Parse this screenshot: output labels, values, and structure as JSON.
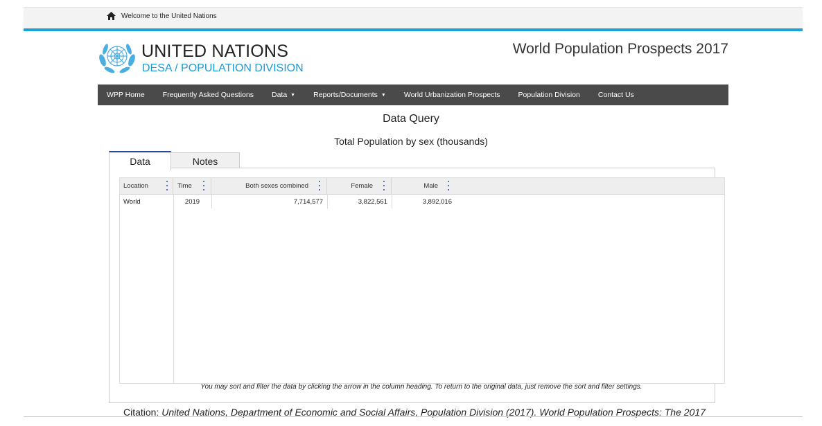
{
  "topbar": {
    "welcome": "Welcome to the United Nations",
    "accent": "#1ba1dc"
  },
  "header": {
    "org_name": "UNITED NATIONS",
    "division": "DESA / POPULATION DIVISION",
    "site_title": "World Population Prospects 2017"
  },
  "nav": {
    "items": [
      {
        "label": "WPP Home"
      },
      {
        "label": "Frequently Asked Questions"
      },
      {
        "label": "Data",
        "caret": "▼"
      },
      {
        "label": "Reports/Documents",
        "caret": "▼"
      },
      {
        "label": "World Urbanization Prospects"
      },
      {
        "label": "Population Division"
      },
      {
        "label": "Contact Us"
      }
    ]
  },
  "query": {
    "title": "Data Query",
    "subtitle": "Total Population by sex (thousands)"
  },
  "tabs": [
    {
      "label": "Data",
      "active": true
    },
    {
      "label": "Notes",
      "active": false
    }
  ],
  "table": {
    "columns": [
      "Location",
      "Time",
      "Both sexes combined",
      "Female",
      "Male"
    ],
    "rows": [
      [
        "World",
        "2019",
        "7,714,577",
        "3,822,561",
        "3,892,016"
      ]
    ]
  },
  "hint": "You may sort and filter the data by clicking the arrow in the column heading. To return to the original data, just remove the sort and filter settings.",
  "citation": {
    "label": "Citation:",
    "text": "United Nations, Department of Economic and Social Affairs, Population Division (2017). World Population Prospects: The 2017"
  }
}
